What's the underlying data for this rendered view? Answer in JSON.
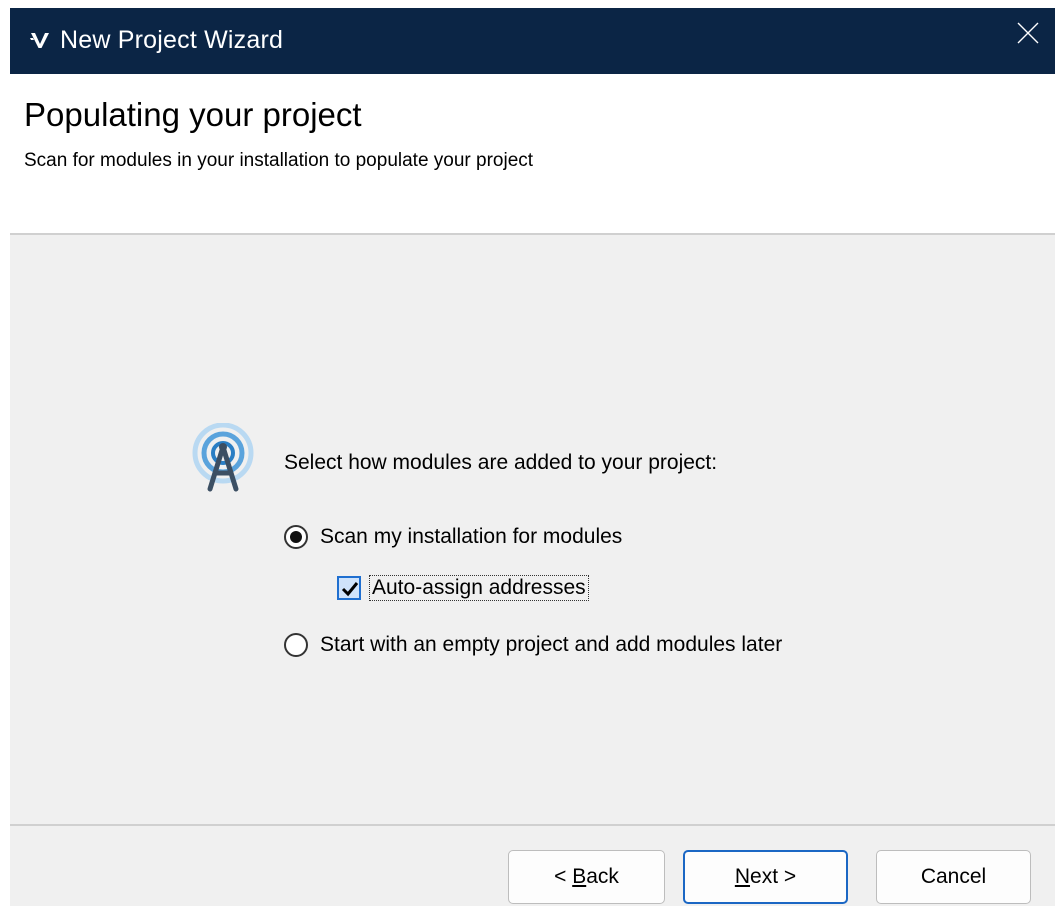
{
  "window": {
    "title": "New Project Wizard",
    "icons": {
      "app": "v-logo-icon",
      "close": "close-icon"
    }
  },
  "header": {
    "title": "Populating your project",
    "subtitle": "Scan for modules in your installation to populate your project"
  },
  "content": {
    "icon": "scan-antenna-icon",
    "prompt": "Select how modules are added to your project:",
    "options": [
      {
        "label": "Scan my installation for modules",
        "selected": true
      },
      {
        "label": "Start with an empty project and add modules later",
        "selected": false
      }
    ],
    "auto_assign": {
      "label": "Auto-assign addresses",
      "checked": true
    }
  },
  "buttons": {
    "back": {
      "prefix": "< ",
      "mnemonic": "B",
      "rest": "ack"
    },
    "next": {
      "mnemonic": "N",
      "rest": "ext >"
    },
    "cancel": "Cancel"
  },
  "colors": {
    "titlebar": "#0b2545",
    "accent": "#1b67c4",
    "panel": "#f0f0f0"
  }
}
